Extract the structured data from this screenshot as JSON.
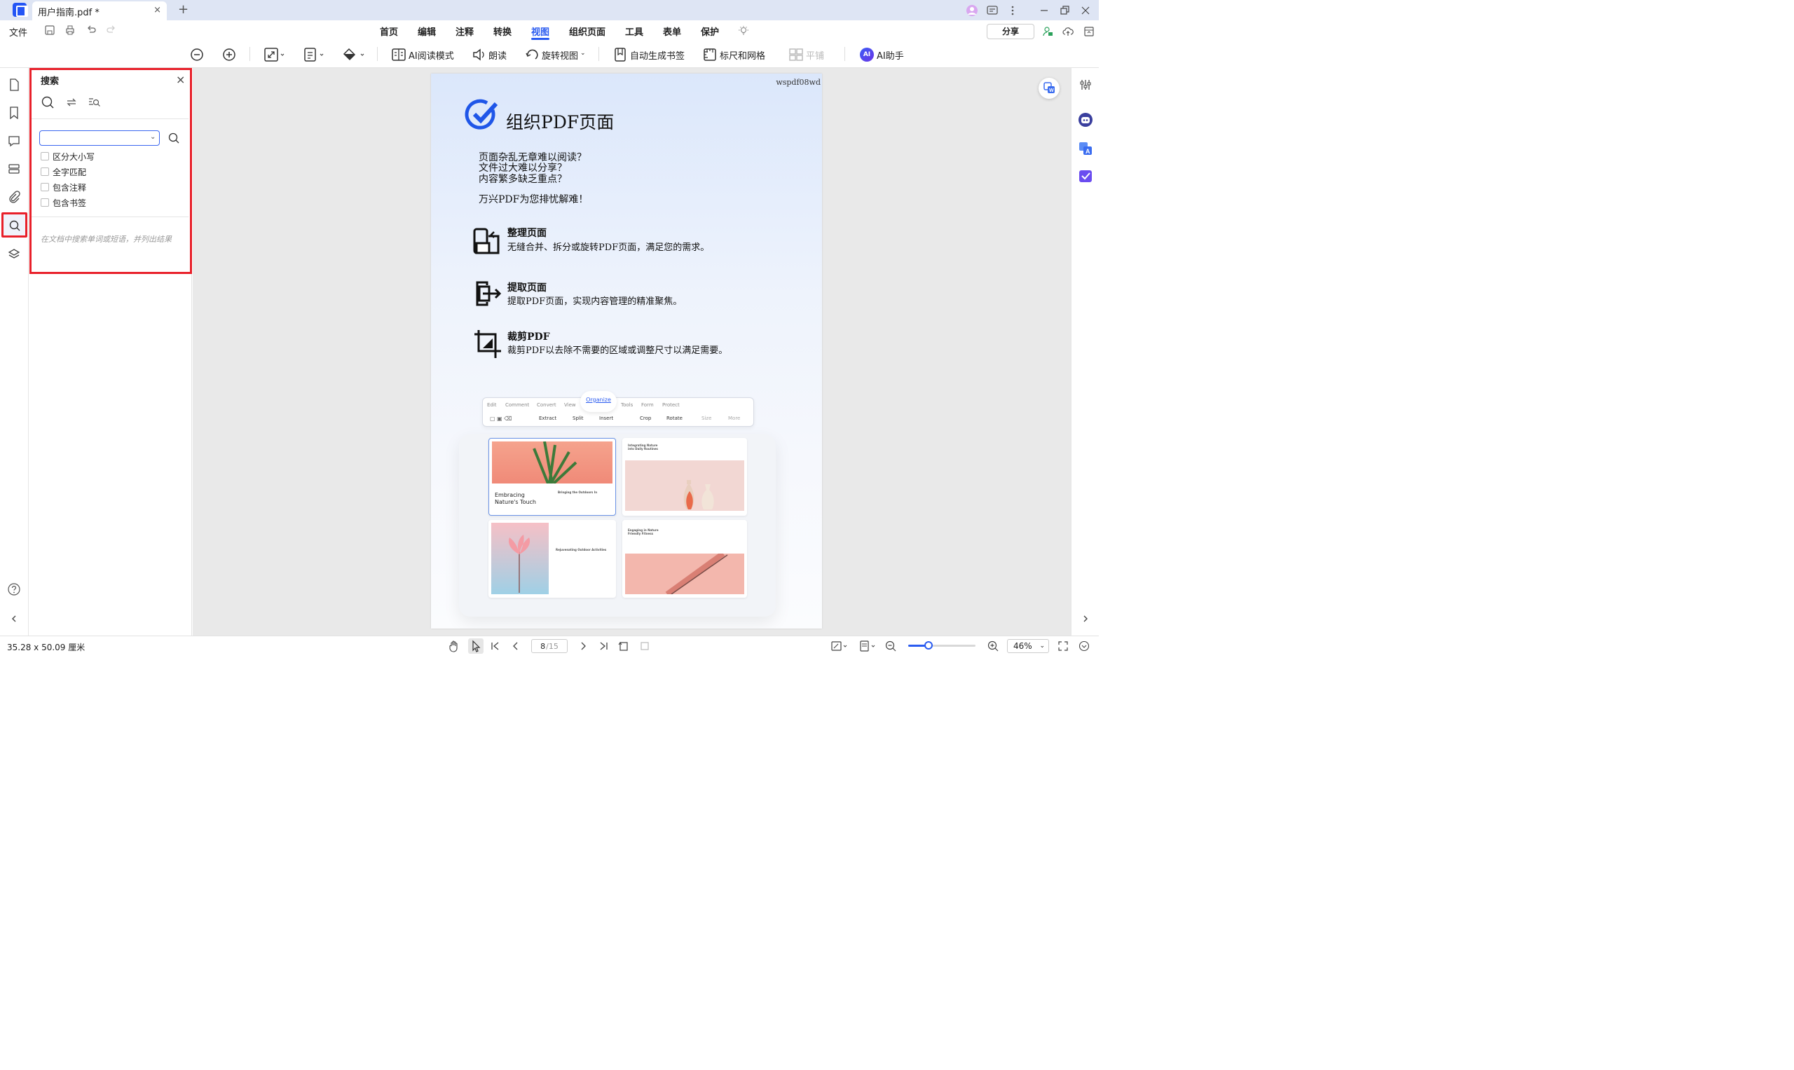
{
  "app": {
    "tab_title": "用户指南.pdf *",
    "tab_close": "×",
    "new_tab": "+"
  },
  "menu": {
    "file": "文件",
    "tabs": [
      "首页",
      "编辑",
      "注释",
      "转换",
      "视图",
      "组织页面",
      "工具",
      "表单",
      "保护"
    ],
    "active_tab": "视图",
    "share": "分享"
  },
  "ribbon": {
    "ai_read": "AI阅读模式",
    "read_aloud": "朗读",
    "rotate_view": "旋转视图",
    "auto_bookmark": "自动生成书签",
    "ruler_grid": "标尺和网格",
    "tile": "平铺",
    "ai_assistant": "AI助手",
    "ai_badge": "AI"
  },
  "search_panel": {
    "title": "搜索",
    "close": "×",
    "input_value": "",
    "options": [
      {
        "label": "区分大小写",
        "checked": false
      },
      {
        "label": "全字匹配",
        "checked": false
      },
      {
        "label": "包含注释",
        "checked": false
      },
      {
        "label": "包含书签",
        "checked": false
      }
    ],
    "hint": "在文档中搜索单词或短语，并列出结果"
  },
  "page": {
    "watermark": "wspdf08wd",
    "heading": "组织PDF页面",
    "intro": [
      "页面杂乱无章难以阅读？",
      "文件过大难以分享？",
      "内容繁多缺乏重点？"
    ],
    "tagline": "万兴PDF为您排忧解难！",
    "features": [
      {
        "title": "整理页面",
        "desc": "无缝合并、拆分或旋转PDF页面，满足您的需求。"
      },
      {
        "title": "提取页面",
        "desc": "提取PDF页面，实现内容管理的精准聚焦。"
      },
      {
        "title": "裁剪PDF",
        "desc": "裁剪PDF以去除不需要的区域或调整尺寸以满足需要。"
      }
    ],
    "mockup": {
      "tabs": [
        "Edit",
        "Comment",
        "Convert",
        "View",
        "Organize",
        "Tools",
        "Form",
        "Protect"
      ],
      "buttons": [
        "Extract",
        "Split",
        "Insert",
        "Crop",
        "Rotate",
        "Size",
        "More"
      ],
      "card1_title": "Embracing Nature's Touch",
      "card1_sub": "Bringing the Outdoors In",
      "card2_title": "Integrating Nature into Daily Routines",
      "card3_title": "Rejuvenating Outdoor Activities",
      "card4_title": "Engaging in Nature Friendly Fitness"
    }
  },
  "status": {
    "page_size": "35.28 x 50.09 厘米",
    "current_page": "8",
    "total_pages": "/15",
    "zoom": "46%",
    "zoom_fraction": 0.3
  },
  "colors": {
    "accent": "#2a5bf0",
    "highlight": "#e8202a"
  }
}
